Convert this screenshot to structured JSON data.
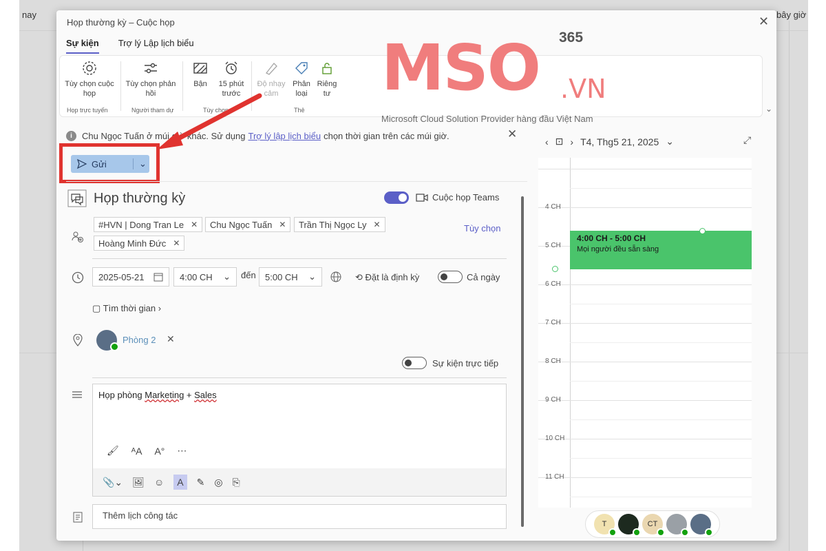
{
  "background": {
    "left_text": "nay",
    "right_text": "bây giờ"
  },
  "dialog": {
    "title": "Họp thường kỳ – Cuộc họp",
    "close": "✕",
    "tabs": [
      {
        "label": "Sự kiện",
        "active": true
      },
      {
        "label": "Trợ lý Lập lịch biểu",
        "active": false
      }
    ]
  },
  "ribbon": {
    "buttons": [
      {
        "label": "Tùy chọn cuộc họp",
        "icon": "gear-icon"
      },
      {
        "label": "Tùy chọn phản hồi",
        "icon": "sliders-icon",
        "dropdown": true
      },
      {
        "label": "Bận",
        "icon": "busy-icon",
        "dropdown": true
      },
      {
        "label": "15 phút trước",
        "icon": "alarm-icon",
        "dropdown": true
      },
      {
        "label": "Độ nhạy cảm",
        "icon": "sensitivity-icon",
        "disabled": true
      },
      {
        "label": "Phân loại",
        "icon": "tag-icon",
        "dropdown": true
      },
      {
        "label": "Riêng tư",
        "icon": "lock-icon"
      }
    ],
    "groups": [
      "Họp trực tuyến",
      "Người tham dự",
      "Tùy chọn",
      "Thẻ"
    ]
  },
  "info_bar": {
    "text_before": "Chu Ngọc Tuấn ở múi giờ khác. Sử dụng",
    "link": "Trợ lý lập lịch biểu",
    "text_after": "chọn thời gian trên các múi giờ."
  },
  "send_button": {
    "label": "Gửi"
  },
  "event": {
    "title": "Họp thường kỳ",
    "teams_label": "Cuộc họp Teams",
    "teams_on": true,
    "attendees": [
      "#HVN | Dong Tran Le",
      "Chu Ngọc Tuấn",
      "Trần Thị Ngọc Ly",
      "Hoàng Minh Đức"
    ],
    "options_label": "Tùy chọn",
    "date": "2025-05-21",
    "start_time": "4:00 CH",
    "to_label": "đến",
    "end_time": "5:00 CH",
    "repeat_label": "Đặt là định kỳ",
    "all_day_label": "Cả ngày",
    "find_time_label": "Tìm thời gian",
    "room": "Phòng 2",
    "live_event_label": "Sự kiện trực tiếp",
    "body_prefix": "Họp phòng ",
    "body_marketing": "Marketing",
    "body_mid": " + ",
    "body_sales": "Sales",
    "note_placeholder": "Thêm lịch công tác"
  },
  "calendar": {
    "date_label": "T4, Thg5 21, 2025",
    "hours": [
      "4 CH",
      "5 CH",
      "6 CH",
      "7 CH",
      "8 CH",
      "9 CH",
      "10 CH",
      "11 CH"
    ],
    "event_time": "4:00 CH - 5:00 CH",
    "event_status": "Mọi người đều sẵn sàng",
    "event_color": "#4ac46b",
    "attendee_initials": [
      "T",
      "",
      "CT",
      "",
      ""
    ]
  },
  "logo": {
    "brand": "MSO",
    "suffix": ".VN",
    "number": "365",
    "tagline": "Microsoft Cloud Solution Provider hàng đầu Việt Nam"
  },
  "colors": {
    "accent": "#5b5fc7",
    "highlight_box": "#e0332f",
    "logo": "#f07d7d"
  }
}
